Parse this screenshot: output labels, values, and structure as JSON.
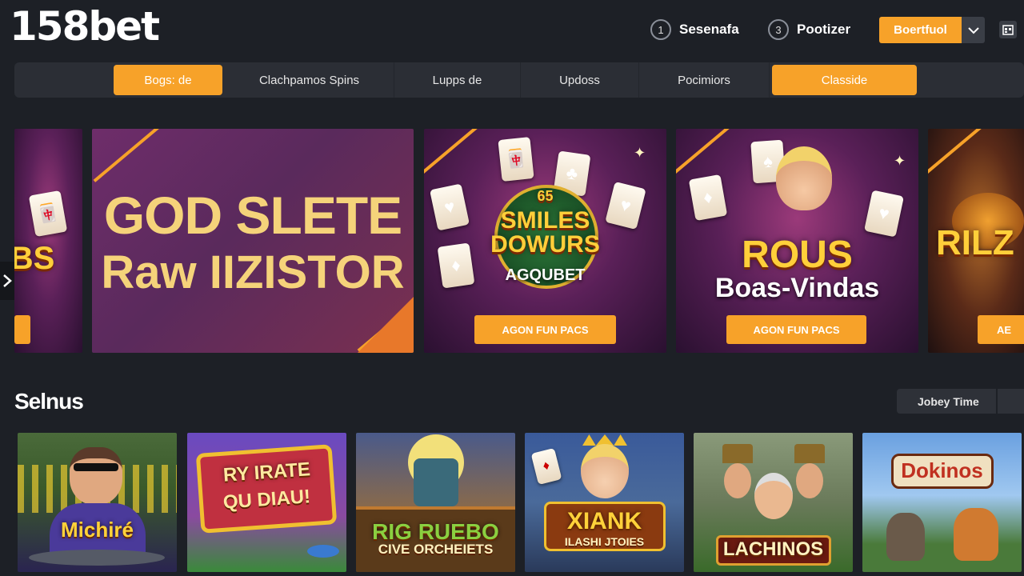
{
  "header": {
    "logo": "158bet",
    "item1": {
      "num": "1",
      "label": "Sesenafa"
    },
    "item2": {
      "num": "3",
      "label": "Pootizer"
    },
    "cta_label": "Boertfuol",
    "accent": "#f7a229"
  },
  "nav": {
    "tabs": [
      {
        "label": "Bogs: de",
        "active": true
      },
      {
        "label": "Clachpamos Spins",
        "active": false
      },
      {
        "label": "Lupps de",
        "active": false
      },
      {
        "label": "Updoss",
        "active": false
      },
      {
        "label": "Pocimiors",
        "active": false
      },
      {
        "label": "Classide",
        "active": true
      }
    ]
  },
  "banners": {
    "b0": {
      "title": "BS",
      "button": ""
    },
    "b1": {
      "title": "GOD SLETE",
      "subtitle": "Raw IIZISTOR"
    },
    "b2": {
      "top": "65",
      "title": "SMILES DOWURS",
      "badge": "AGQUBET",
      "button": "AGON FUN PACS"
    },
    "b3": {
      "title": "ROUS",
      "subtitle": "Boas-Vindas",
      "button": "AGON FUN PACS"
    },
    "b4": {
      "title": "RILZ",
      "button": "AE"
    }
  },
  "section": {
    "title": "Selnus",
    "sort_label": "Jobey Time"
  },
  "games": [
    {
      "name": "Michiré",
      "sub": ""
    },
    {
      "name": "RY IRATE",
      "sub": "QU DIAU!"
    },
    {
      "name": "RIG RUEBO",
      "sub": "CIVE ORCHEIETS"
    },
    {
      "name": "XIANK",
      "sub": "ILASHI JTOIES"
    },
    {
      "name": "LACHINOS",
      "sub": ""
    },
    {
      "name": "Dokinos",
      "sub": ""
    }
  ]
}
